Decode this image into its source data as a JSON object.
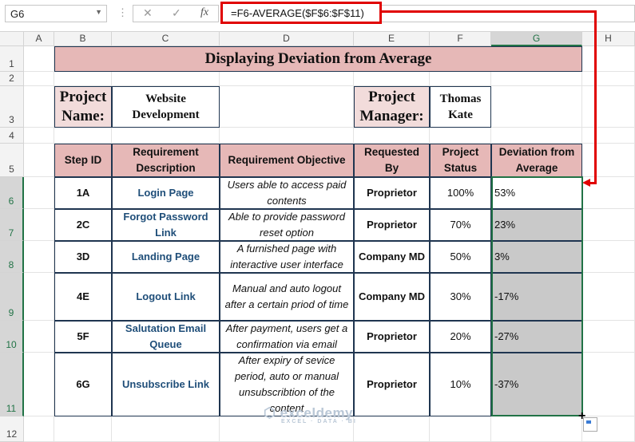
{
  "toolbar": {
    "name_box": "G6",
    "formula": "=F6-AVERAGE($F$6:$F$11)",
    "fx_label": "fx",
    "cancel": "✕",
    "enter": "✓"
  },
  "columns": [
    "A",
    "B",
    "C",
    "D",
    "E",
    "F",
    "G",
    "H"
  ],
  "rows": [
    "1",
    "2",
    "3",
    "4",
    "5",
    "6",
    "7",
    "8",
    "9",
    "10",
    "11",
    "12"
  ],
  "title": "Displaying Deviation from Average",
  "project": {
    "name_label": "Project Name:",
    "name_value": "Website Development",
    "manager_label": "Project Manager:",
    "manager_value": "Thomas Kate"
  },
  "table": {
    "headers": [
      "Step ID",
      "Requirement Description",
      "Requirement Objective",
      "Requested By",
      "Project Status",
      "Deviation from Average"
    ],
    "rows": [
      {
        "id": "1A",
        "desc": "Login Page",
        "obj": "Users able to access paid contents",
        "req": "Proprietor",
        "status": "100%",
        "dev": "53%"
      },
      {
        "id": "2C",
        "desc": "Forgot Password Link",
        "obj": "Able to provide password reset option",
        "req": "Proprietor",
        "status": "70%",
        "dev": "23%"
      },
      {
        "id": "3D",
        "desc": "Landing Page",
        "obj": "A furnished page with interactive user interface",
        "req": "Company MD",
        "status": "50%",
        "dev": "3%"
      },
      {
        "id": "4E",
        "desc": "Logout Link",
        "obj": "Manual and auto logout after a certain priod of time",
        "req": "Company MD",
        "status": "30%",
        "dev": "-17%"
      },
      {
        "id": "5F",
        "desc": "Salutation Email Queue",
        "obj": "After payment, users get a confirmation via email",
        "req": "Proprietor",
        "status": "20%",
        "dev": "-27%"
      },
      {
        "id": "6G",
        "desc": "Unsubscribe Link",
        "obj": "After expiry of sevice period, auto or manual unsubscribtion of the content",
        "req": "Proprietor",
        "status": "10%",
        "dev": "-37%"
      }
    ]
  },
  "watermark": {
    "name": "exceldemy",
    "tagline": "EXCEL · DATA · BI"
  },
  "colors": {
    "header_fill": "#e6b8b7",
    "label_fill": "#f2dcdb",
    "selection": "#217346",
    "annotation": "#e00000"
  }
}
